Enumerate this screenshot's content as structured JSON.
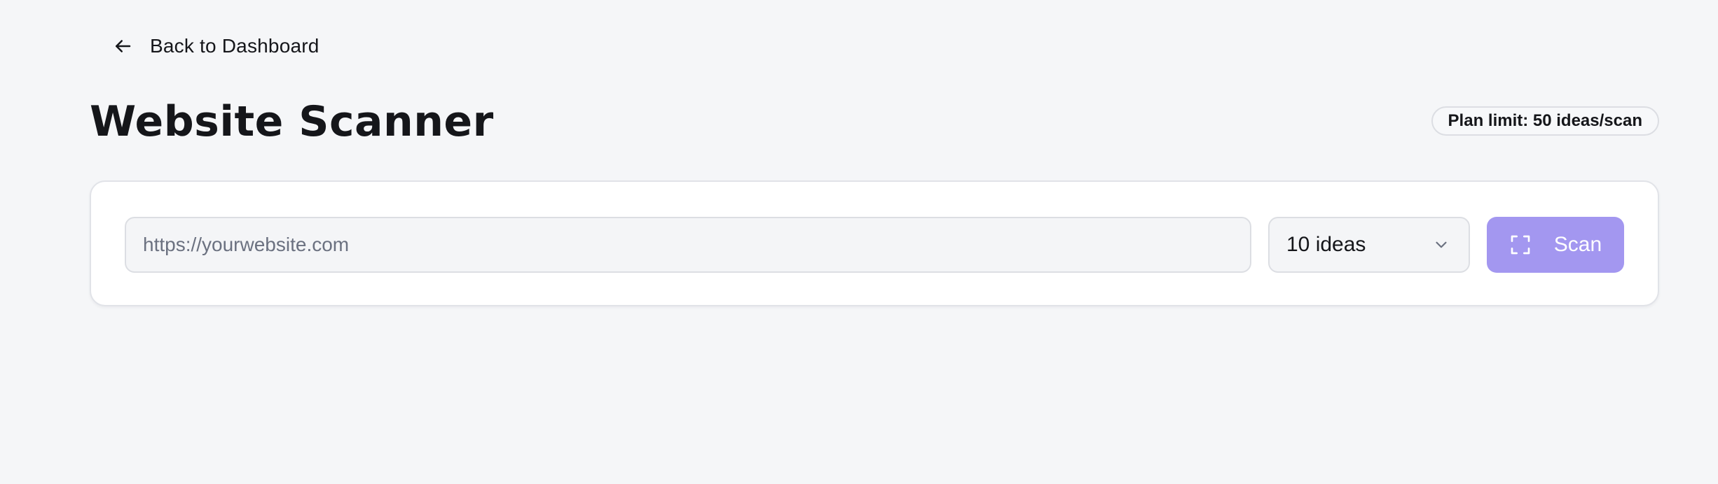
{
  "nav": {
    "back_label": "Back to Dashboard",
    "back_icon": "arrow-left-icon"
  },
  "header": {
    "title": "Website Scanner",
    "plan_badge": "Plan limit: 50 ideas/scan"
  },
  "scanner": {
    "url_placeholder": "https://yourwebsite.com",
    "url_value": "",
    "count_selected": "10 ideas",
    "count_icon": "chevron-down-icon",
    "scan_label": "Scan",
    "scan_icon": "scan-frame-icon"
  },
  "colors": {
    "background": "#f5f6f8",
    "accent": "#a397f0",
    "text": "#15161a",
    "placeholder": "#6b7180"
  }
}
